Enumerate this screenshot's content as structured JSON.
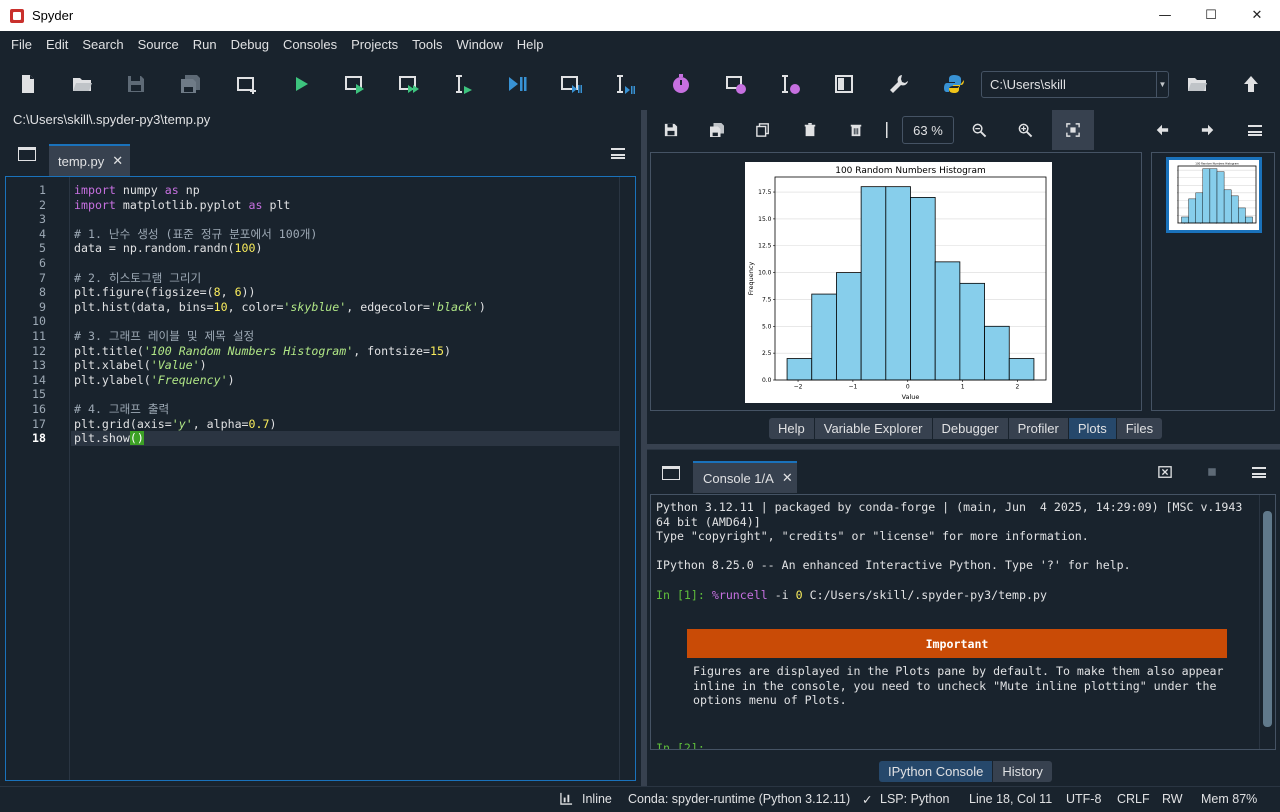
{
  "window": {
    "title": "Spyder",
    "minimize": "—",
    "maximize": "☐",
    "close": "✕"
  },
  "menu": [
    "File",
    "Edit",
    "Search",
    "Source",
    "Run",
    "Debug",
    "Consoles",
    "Projects",
    "Tools",
    "Window",
    "Help"
  ],
  "toolbar": {
    "working_dir": "C:\\Users\\skill"
  },
  "editor": {
    "file_path": "C:\\Users\\skill\\.spyder-py3\\temp.py",
    "tab_label": "temp.py",
    "tab_close": "✕",
    "current_line": 18,
    "lines": [
      "import numpy as np",
      "import matplotlib.pyplot as plt",
      "",
      "# 1. 난수 생성 (표준 정규 분포에서 100개)",
      "data = np.random.randn(100)",
      "",
      "# 2. 히스토그램 그리기",
      "plt.figure(figsize=(8, 6))",
      "plt.hist(data, bins=10, color='skyblue', edgecolor='black')",
      "",
      "# 3. 그래프 레이블 및 제목 설정",
      "plt.title('100 Random Numbers Histogram', fontsize=15)",
      "plt.xlabel('Value')",
      "plt.ylabel('Frequency')",
      "",
      "# 4. 그래프 출력",
      "plt.grid(axis='y', alpha=0.7)",
      "plt.show()"
    ]
  },
  "plots": {
    "zoom": "63 %",
    "tabs": [
      {
        "label": "Help",
        "active": false
      },
      {
        "label": "Variable Explorer",
        "active": false
      },
      {
        "label": "Debugger",
        "active": false
      },
      {
        "label": "Profiler",
        "active": false
      },
      {
        "label": "Plots",
        "active": true
      },
      {
        "label": "Files",
        "active": false
      }
    ]
  },
  "chart_data": {
    "type": "bar",
    "title": "100 Random Numbers Histogram",
    "xlabel": "Value",
    "ylabel": "Frequency",
    "bins": [
      {
        "start": -2.2,
        "end": -1.75,
        "value": 2
      },
      {
        "start": -1.75,
        "end": -1.3,
        "value": 8
      },
      {
        "start": -1.3,
        "end": -0.85,
        "value": 10
      },
      {
        "start": -0.85,
        "end": -0.4,
        "value": 18
      },
      {
        "start": -0.4,
        "end": 0.05,
        "value": 18
      },
      {
        "start": 0.05,
        "end": 0.5,
        "value": 17
      },
      {
        "start": 0.5,
        "end": 0.95,
        "value": 11
      },
      {
        "start": 0.95,
        "end": 1.4,
        "value": 9
      },
      {
        "start": 1.4,
        "end": 1.85,
        "value": 5
      },
      {
        "start": 1.85,
        "end": 2.3,
        "value": 2
      }
    ],
    "xlim": [
      -2.42,
      2.52
    ],
    "ylim": [
      0,
      18.9
    ],
    "xticks": [
      -2,
      -1,
      0,
      1,
      2
    ],
    "xtick_labels": [
      "−2",
      "−1",
      "0",
      "1",
      "2"
    ],
    "yticks": [
      0,
      2.5,
      5,
      7.5,
      10,
      12.5,
      15,
      17.5
    ],
    "ytick_labels": [
      "0.0",
      "2.5",
      "5.0",
      "7.5",
      "10.0",
      "12.5",
      "15.0",
      "17.5"
    ],
    "bar_color": "#87ceeb",
    "edge_color": "#000000",
    "grid": "y"
  },
  "console": {
    "tab_label": "Console 1/A",
    "tab_close": "✕",
    "banner": "Python 3.12.11 | packaged by conda-forge | (main, Jun  4 2025, 14:29:09) [MSC v.1943 64 bit (AMD64)]\nType \"copyright\", \"credits\" or \"license\" for more information.\n\nIPython 8.25.0 -- An enhanced Interactive Python. Type '?' for help.",
    "in1_prompt": "In [1]:",
    "in1_magic": "%runcell",
    "in1_flag": "-i",
    "in1_zero": "0",
    "in1_path": "C:/Users/skill/.spyder-py3/temp.py",
    "important_title": "Important",
    "important_msg": "Figures are displayed in the Plots pane by default. To make them also appear inline in the console, you need to uncheck \"Mute inline plotting\" under the options menu of Plots.",
    "in2_prompt": "In [2]:",
    "tabs": [
      {
        "label": "IPython Console",
        "active": true
      },
      {
        "label": "History",
        "active": false
      }
    ]
  },
  "status": {
    "inline": "Inline",
    "conda": "Conda: spyder-runtime (Python 3.12.11)",
    "lsp": "LSP: Python",
    "position": "Line 18, Col 11",
    "encoding": "UTF-8",
    "eol": "CRLF",
    "rw": "RW",
    "mem": "Mem 87%"
  },
  "colors": {
    "accent": "#1a72bb",
    "background": "#19232d",
    "important": "#c94b06"
  }
}
